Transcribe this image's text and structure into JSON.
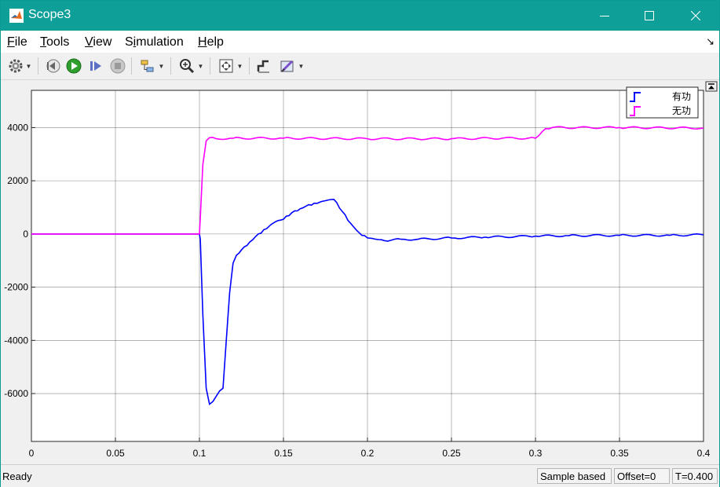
{
  "window": {
    "title": "Scope3",
    "minimize_glyph": "—",
    "maximize_glyph": "☐",
    "close_glyph": "✕"
  },
  "menu": {
    "items": [
      {
        "pre": "",
        "key": "F",
        "post": "ile"
      },
      {
        "pre": "",
        "key": "T",
        "post": "ools"
      },
      {
        "pre": "",
        "key": "V",
        "post": "iew"
      },
      {
        "pre": "S",
        "key": "i",
        "post": "mulation"
      },
      {
        "pre": "",
        "key": "H",
        "post": "elp"
      }
    ],
    "dock_glyph": "↘"
  },
  "toolbar": {
    "icons": [
      "gear-icon",
      "step-back-icon",
      "run-icon",
      "step-forward-icon",
      "stop-icon",
      "signal-select-icon",
      "zoom-icon",
      "fit-to-view-icon",
      "cursor-measure-icon",
      "style-icon"
    ]
  },
  "status": {
    "ready": "Ready",
    "sample_mode": "Sample based",
    "offset": "Offset=0",
    "time": "T=0.400"
  },
  "colors": {
    "titlebar": "#0e9f99",
    "series_active": "#0000ff",
    "series_reactive": "#ff00ff"
  },
  "chart_data": {
    "type": "line",
    "title": "",
    "xlabel": "",
    "ylabel": "",
    "xlim": [
      0,
      0.4
    ],
    "ylim": [
      -7800,
      5400
    ],
    "xticks": [
      0,
      0.05,
      0.1,
      0.15,
      0.2,
      0.25,
      0.3,
      0.35,
      0.4
    ],
    "xtick_labels": [
      "0",
      "0.05",
      "0.1",
      "0.15",
      "0.2",
      "0.25",
      "0.3",
      "0.35",
      "0.4"
    ],
    "yticks": [
      -6000,
      -4000,
      -2000,
      0,
      2000,
      4000
    ],
    "ytick_labels": [
      "-6000",
      "-4000",
      "-2000",
      "0",
      "2000",
      "4000"
    ],
    "grid": true,
    "legend_position": "top-right",
    "series": [
      {
        "name": "有功",
        "color": "#0000ff",
        "x": [
          0,
          0.1,
          0.1005,
          0.102,
          0.104,
          0.106,
          0.108,
          0.11,
          0.112,
          0.114,
          0.116,
          0.118,
          0.12,
          0.122,
          0.125,
          0.13,
          0.135,
          0.14,
          0.145,
          0.15,
          0.155,
          0.16,
          0.165,
          0.17,
          0.175,
          0.18,
          0.185,
          0.19,
          0.195,
          0.2,
          0.205,
          0.21,
          0.22,
          0.23,
          0.25,
          0.27,
          0.3,
          0.32,
          0.35,
          0.38,
          0.4
        ],
        "y": [
          0,
          0,
          -200,
          -3000,
          -5800,
          -6400,
          -6300,
          -6100,
          -5900,
          -5800,
          -4000,
          -2200,
          -1100,
          -800,
          -600,
          -300,
          0,
          200,
          450,
          550,
          800,
          950,
          1100,
          1150,
          1250,
          1300,
          850,
          400,
          50,
          -150,
          -200,
          -250,
          -200,
          -200,
          -150,
          -120,
          -80,
          -60,
          -50,
          -50,
          -30
        ]
      },
      {
        "name": "无功",
        "color": "#ff00ff",
        "x": [
          0,
          0.1,
          0.1005,
          0.102,
          0.104,
          0.106,
          0.11,
          0.12,
          0.15,
          0.2,
          0.25,
          0.28,
          0.3,
          0.302,
          0.304,
          0.306,
          0.31,
          0.35,
          0.4
        ],
        "y": [
          0,
          0,
          600,
          2600,
          3500,
          3620,
          3580,
          3600,
          3600,
          3580,
          3580,
          3600,
          3600,
          3700,
          3850,
          3960,
          4000,
          4000,
          3980
        ]
      }
    ]
  }
}
